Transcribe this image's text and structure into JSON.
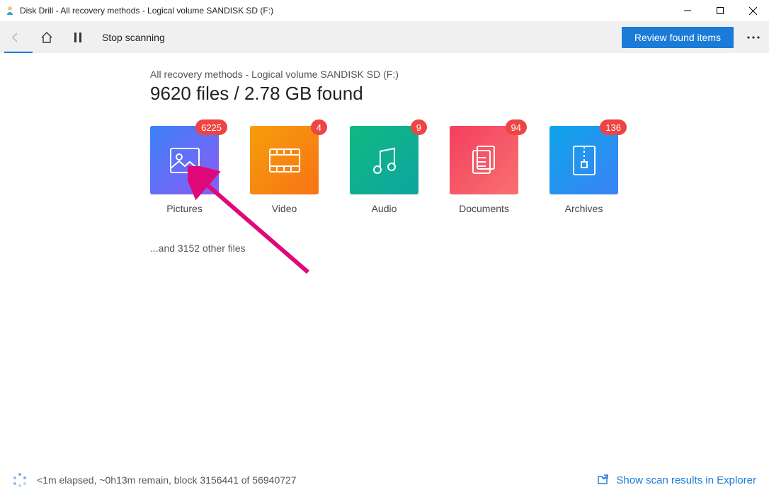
{
  "titlebar": {
    "text": "Disk Drill - All recovery methods - Logical volume SANDISK SD (F:)"
  },
  "toolbar": {
    "stop_label": "Stop scanning",
    "review_label": "Review found items"
  },
  "content": {
    "subtitle": "All recovery methods - Logical volume SANDISK SD (F:)",
    "headline": "9620 files / 2.78 GB found",
    "other_files": "...and 3152 other files"
  },
  "tiles": [
    {
      "key": "pictures",
      "label": "Pictures",
      "count": "6225",
      "css": "tile-pictures",
      "icon": "image-icon"
    },
    {
      "key": "video",
      "label": "Video",
      "count": "4",
      "css": "tile-video",
      "icon": "film-icon"
    },
    {
      "key": "audio",
      "label": "Audio",
      "count": "9",
      "css": "tile-audio",
      "icon": "music-icon"
    },
    {
      "key": "documents",
      "label": "Documents",
      "count": "94",
      "css": "tile-docs",
      "icon": "document-icon"
    },
    {
      "key": "archives",
      "label": "Archives",
      "count": "136",
      "css": "tile-arch",
      "icon": "archive-icon"
    }
  ],
  "statusbar": {
    "text": "<1m elapsed, ~0h13m remain, block 3156441 of 56940727",
    "show_link": "Show scan results in Explorer"
  }
}
